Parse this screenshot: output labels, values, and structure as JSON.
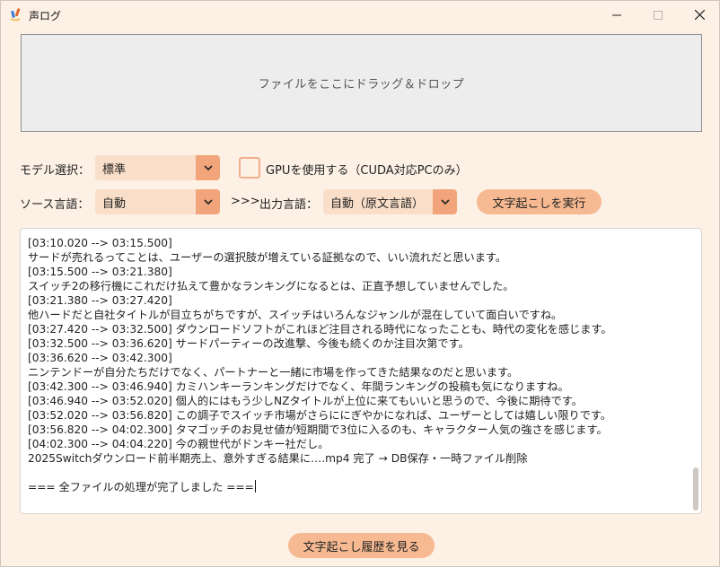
{
  "window": {
    "title": "声ログ",
    "minimize_icon": "minimize-icon",
    "maximize_icon": "maximize-icon",
    "close_icon": "close-icon"
  },
  "drop_zone": {
    "text": "ファイルをここにドラッグ＆ドロップ"
  },
  "model": {
    "label": "モデル選択：",
    "value": "標準"
  },
  "gpu": {
    "label": "GPUを使用する（CUDA対応PCのみ）",
    "checked": false
  },
  "source_lang": {
    "label": "ソース言語：",
    "value": "自動"
  },
  "arrow_text": ">>>",
  "output_lang": {
    "label": "出力言語：",
    "value": "自動（原文言語）"
  },
  "run_button": "文字起こしを実行",
  "log_lines": [
    "[03:10.020 --> 03:15.500]",
    "サードが売れるってことは、ユーザーの選択肢が増えている証拠なので、いい流れだと思います。",
    "[03:15.500 --> 03:21.380]",
    "スイッチ2の移行機にこれだけ払えて豊かなランキングになるとは、正直予想していませんでした。",
    "[03:21.380 --> 03:27.420]",
    "他ハードだと自社タイトルが目立ちがちですが、スイッチはいろんなジャンルが混在していて面白いですね。",
    "[03:27.420 --> 03:32.500] ダウンロードソフトがこれほど注目される時代になったことも、時代の変化を感じます。",
    "[03:32.500 --> 03:36.620] サードパーティーの改進撃、今後も続くのか注目次第です。",
    "[03:36.620 --> 03:42.300]",
    "ニンテンドーが自分たちだけでなく、パートナーと一緒に市場を作ってきた結果なのだと思います。",
    "[03:42.300 --> 03:46.940] カミハンキーランキングだけでなく、年間ランキングの投稿も気になりますね。",
    "[03:46.940 --> 03:52.020] 個人的にはもう少しNZタイトルが上位に来てもいいと思うので、今後に期待です。",
    "[03:52.020 --> 03:56.820] この調子でスイッチ市場がさらににぎやかになれば、ユーザーとしては嬉しい限りです。",
    "[03:56.820 --> 04:02.300] タマゴッチのお見せ値が短期間で3位に入るのも、キャラクター人気の強さを感じます。",
    "[04:02.300 --> 04:04.220] 今の親世代がドンキー社だし。",
    "2025Switchダウンロード前半期売上、意外すぎる結果に….mp4 完了 → DB保存・一時ファイル削除",
    "",
    "=== 全ファイルの処理が完了しました ==="
  ],
  "history_button": "文字起こし履歴を見る",
  "colors": {
    "background": "#fdf1e6",
    "accent": "#f2a57a",
    "button": "#f6b992",
    "combo": "#f9dfc9"
  }
}
